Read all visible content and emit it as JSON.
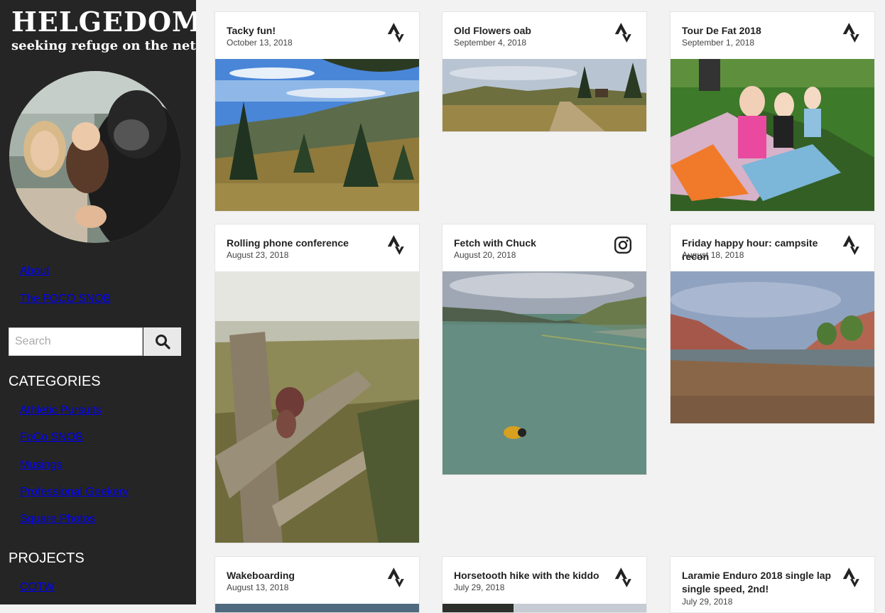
{
  "site": {
    "title": "HELGEDOM",
    "tagline": "seeking refuge on the net"
  },
  "nav": {
    "pages": [
      "About",
      "The FOCO SNOB"
    ]
  },
  "search": {
    "placeholder": "Search"
  },
  "categories": {
    "heading": "CATEGORIES",
    "items": [
      "Athletic Pursuits",
      "FoCo SNOB",
      "Musings",
      "Professional Geekery",
      "Square Photos"
    ]
  },
  "projects": {
    "heading": "PROJECTS",
    "items": [
      "COTW"
    ]
  },
  "posts": [
    {
      "title": "Tacky fun!",
      "date": "October 13, 2018",
      "icon": "strava-icon"
    },
    {
      "title": "Old Flowers oab",
      "date": "September 4, 2018",
      "icon": "strava-icon"
    },
    {
      "title": "Tour De Fat 2018",
      "date": "September 1, 2018",
      "icon": "strava-icon"
    },
    {
      "title": "Rolling phone conference",
      "date": "August 23, 2018",
      "icon": "strava-icon"
    },
    {
      "title": "Fetch with Chuck",
      "date": "August 20, 2018",
      "icon": "instagram-icon"
    },
    {
      "title": "Friday happy hour: campsite recon",
      "date": "August 18, 2018",
      "icon": "strava-icon"
    },
    {
      "title": "Wakeboarding",
      "date": "August 13, 2018",
      "icon": "strava-icon"
    },
    {
      "title": "Horsetooth hike with the kiddo",
      "date": "July 29, 2018",
      "icon": "strava-icon"
    },
    {
      "title": "Laramie Enduro 2018 single lap single speed, 2nd!",
      "date": "July 29, 2018",
      "icon": "strava-icon"
    }
  ],
  "colors": {
    "sidebar": "#252525",
    "background": "#f2f2f2",
    "card": "#ffffff"
  }
}
